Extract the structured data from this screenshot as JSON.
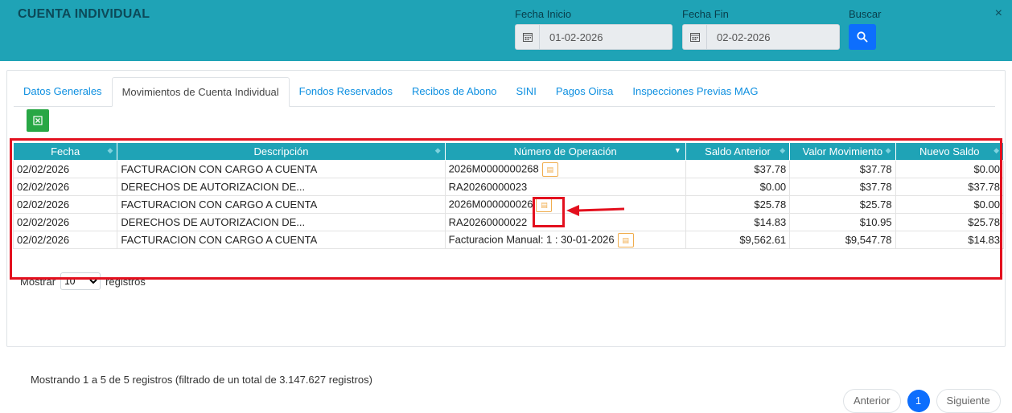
{
  "header": {
    "title": "CUENTA INDIVIDUAL",
    "fecha_inicio_label": "Fecha Inicio",
    "fecha_inicio_value": "01-02-2026",
    "fecha_fin_label": "Fecha Fin",
    "fecha_fin_value": "02-02-2026",
    "buscar_label": "Buscar",
    "close_glyph": "×"
  },
  "tabs": [
    {
      "label": "Datos Generales"
    },
    {
      "label": "Movimientos de Cuenta Individual"
    },
    {
      "label": "Fondos Reservados"
    },
    {
      "label": "Recibos de Abono"
    },
    {
      "label": "SINI"
    },
    {
      "label": "Pagos Oirsa"
    },
    {
      "label": "Inspecciones Previas MAG"
    }
  ],
  "active_tab": 1,
  "table": {
    "columns": [
      "Fecha",
      "Descripción",
      "Número de Operación",
      "Saldo Anterior",
      "Valor Movimiento",
      "Nuevo Saldo"
    ],
    "rows": [
      {
        "fecha": "02/02/2026",
        "descripcion": "FACTURACION CON CARGO A CUENTA",
        "operacion": "2026M0000000268",
        "has_icon": true,
        "saldo_anterior": "$37.78",
        "valor": "$37.78",
        "nuevo": "$0.00"
      },
      {
        "fecha": "02/02/2026",
        "descripcion": "DERECHOS DE AUTORIZACION DE...",
        "operacion": "RA20260000023",
        "has_icon": false,
        "saldo_anterior": "$0.00",
        "valor": "$37.78",
        "nuevo": "$37.78"
      },
      {
        "fecha": "02/02/2026",
        "descripcion": "FACTURACION CON CARGO A CUENTA",
        "operacion": "2026M000000026",
        "has_icon": true,
        "saldo_anterior": "$25.78",
        "valor": "$25.78",
        "nuevo": "$0.00"
      },
      {
        "fecha": "02/02/2026",
        "descripcion": "DERECHOS DE AUTORIZACION DE...",
        "operacion": "RA20260000022",
        "has_icon": false,
        "saldo_anterior": "$14.83",
        "valor": "$10.95",
        "nuevo": "$25.78"
      },
      {
        "fecha": "02/02/2026",
        "descripcion": "FACTURACION CON CARGO A CUENTA",
        "operacion": "Facturacion Manual: 1 : 30-01-2026",
        "has_icon": true,
        "saldo_anterior": "$9,562.61",
        "valor": "$9,547.78",
        "nuevo": "$14.83"
      }
    ]
  },
  "entries": {
    "prefix": "Mostrar",
    "value": "10",
    "suffix": "registros"
  },
  "info_text": "Mostrando 1 a 5 de 5 registros (filtrado de un total de 3.147.627 registros)",
  "pager": {
    "prev": "Anterior",
    "current": "1",
    "next": "Siguiente"
  },
  "colors": {
    "header_bg": "#1fa3b6",
    "accent_blue": "#0d6efd",
    "highlight_red": "#e3101e",
    "excel_green": "#28a745"
  },
  "icons": {
    "calendar": "calendar-icon",
    "search": "search-icon",
    "excel": "excel-icon",
    "receipt": "receipt-icon",
    "close": "close-icon"
  }
}
